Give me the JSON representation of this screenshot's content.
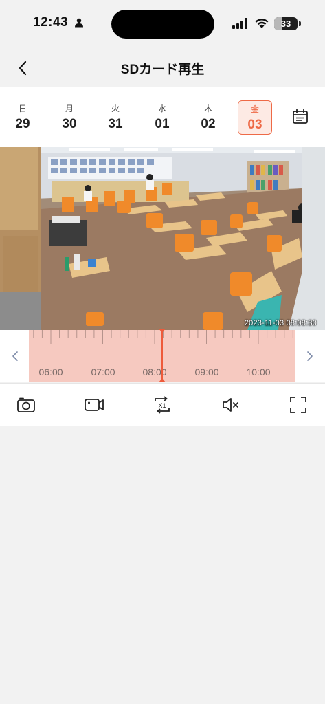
{
  "status_bar": {
    "time": "12:43",
    "battery_level": "33",
    "battery_fraction": 0.33
  },
  "nav": {
    "title": "SDカード再生",
    "back_icon": "chevron-left-icon"
  },
  "date_strip": {
    "days": [
      {
        "dow": "日",
        "num": "29",
        "selected": false
      },
      {
        "dow": "月",
        "num": "30",
        "selected": false
      },
      {
        "dow": "火",
        "num": "31",
        "selected": false
      },
      {
        "dow": "水",
        "num": "01",
        "selected": false
      },
      {
        "dow": "木",
        "num": "02",
        "selected": false
      },
      {
        "dow": "金",
        "num": "03",
        "selected": true
      }
    ],
    "calendar_icon": "calendar-icon",
    "selected_color": "#ee6a47"
  },
  "video": {
    "timestamp": "2023-11-03 08:08:30"
  },
  "timeline": {
    "labels": [
      "06:00",
      "07:00",
      "08:00",
      "09:00",
      "10:00"
    ],
    "current_time": "08:08:30",
    "recorded_color": "#f6c9c0",
    "cursor_color": "#ee5a3a"
  },
  "controls": {
    "items": [
      {
        "name": "snapshot",
        "icon": "camera-icon"
      },
      {
        "name": "record",
        "icon": "video-camera-icon"
      },
      {
        "name": "speed",
        "icon": "speed-x1-icon",
        "label": "X1"
      },
      {
        "name": "mute",
        "icon": "speaker-muted-icon"
      },
      {
        "name": "fullscreen",
        "icon": "fullscreen-icon"
      }
    ]
  }
}
